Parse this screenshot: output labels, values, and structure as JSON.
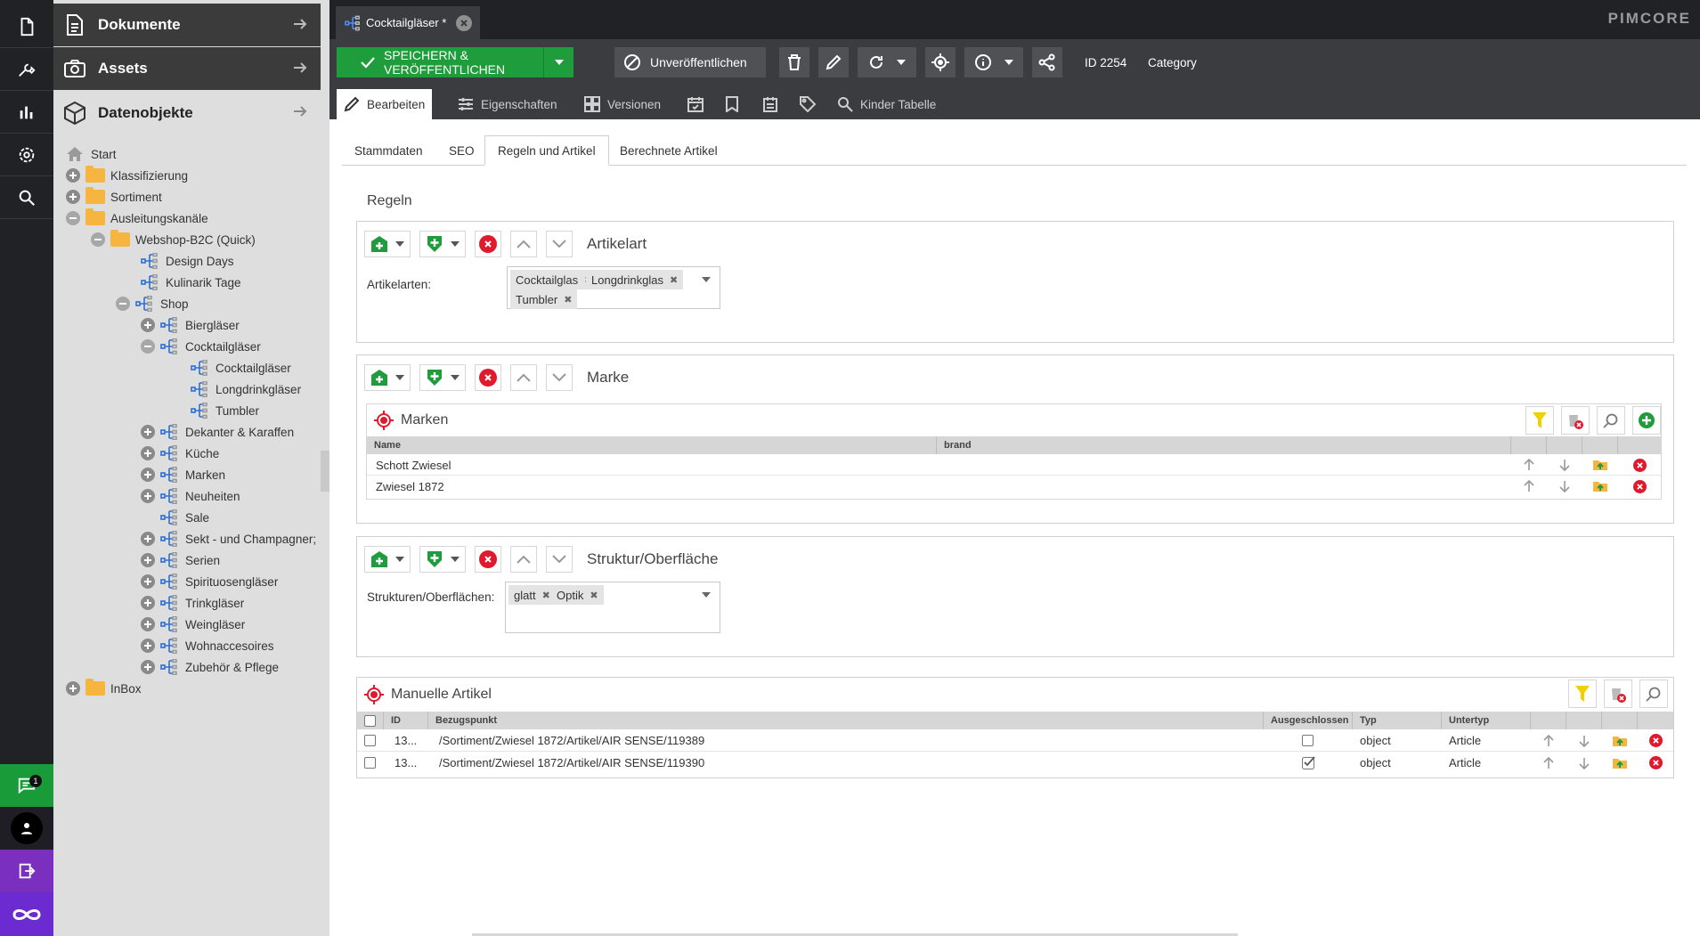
{
  "tree": {
    "accordion": [
      {
        "label": "Dokumente",
        "icon": "document-icon"
      },
      {
        "label": "Assets",
        "icon": "camera-icon"
      },
      {
        "label": "Datenobjekte",
        "icon": "cube-icon"
      }
    ],
    "nodes": {
      "start": "Start",
      "klassifizierung": "Klassifizierung",
      "sortiment": "Sortiment",
      "ausleitungskanaele": "Ausleitungskanäle",
      "webshop": "Webshop-B2C (Quick)",
      "design_days": "Design Days",
      "kulinarik": "Kulinarik Tage",
      "shop": "Shop",
      "bierglaeser": "Biergläser",
      "cocktailglaeser": "Cocktailgläser",
      "cocktailglaeser_sub": "Cocktailgläser",
      "longdrinkglaeser": "Longdrinkgläser",
      "tumbler": "Tumbler",
      "dekanter": "Dekanter & Karaffen",
      "kueche": "Küche",
      "marken": "Marken",
      "neuheiten": "Neuheiten",
      "sale": "Sale",
      "sekt": "Sekt - und Champagner;",
      "serien": "Serien",
      "spirituosen": "Spirituosengläser",
      "trinkglaeser": "Trinkgläser",
      "weinglaeser": "Weingläser",
      "wohnaccesoires": "Wohnaccesoires",
      "zubehoer": "Zubehör & Pflege",
      "inbox": "InBox"
    }
  },
  "iconbar": {
    "chat_badge": "1"
  },
  "header": {
    "tab_title": "Cocktailgläser *",
    "brand": "PIMCORE"
  },
  "toolbar": {
    "save_label": "SPEICHERN & VERÖFFENTLICHEN",
    "unpublish_label": "Unveröffentlichen",
    "id_label": "ID 2254",
    "class_label": "Category"
  },
  "tabs": {
    "edit": "Bearbeiten",
    "properties": "Eigenschaften",
    "versions": "Versionen",
    "children": "Kinder Tabelle"
  },
  "subtabs": [
    "Stammdaten",
    "SEO",
    "Regeln und Artikel",
    "Berechnete Artikel"
  ],
  "rules": {
    "heading": "Regeln",
    "artikelart": {
      "title": "Artikelart",
      "field_label": "Artikelarten:",
      "tags": [
        "Cocktailglas",
        "Longdrinkglas",
        "Tumbler"
      ]
    },
    "marke": {
      "title": "Marke",
      "grid_title": "Marken",
      "columns": [
        "Name",
        "brand"
      ],
      "rows": [
        {
          "name": "Schott Zwiesel",
          "brand": ""
        },
        {
          "name": "Zwiesel 1872",
          "brand": ""
        }
      ]
    },
    "struktur": {
      "title": "Struktur/Oberfläche",
      "field_label": "Strukturen/Oberflächen:",
      "tags": [
        "glatt",
        "Optik"
      ]
    }
  },
  "manual": {
    "title": "Manuelle Artikel",
    "columns": [
      "ID",
      "Bezugspunkt",
      "Ausgeschlossen",
      "Typ",
      "Untertyp"
    ],
    "rows": [
      {
        "id": "13...",
        "path": "/Sortiment/Zwiesel 1872/Artikel/AIR SENSE/119389",
        "excluded": false,
        "type": "object",
        "subtype": "Article"
      },
      {
        "id": "13...",
        "path": "/Sortiment/Zwiesel 1872/Artikel/AIR SENSE/119390",
        "excluded": true,
        "type": "object",
        "subtype": "Article"
      }
    ]
  },
  "colors": {
    "accent_green": "#1f9c3b",
    "danger_red": "#e0192d",
    "filter_yellow": "#f2d000",
    "sidebar_dark": "#202225",
    "toolbar_dark": "#3b3c3f"
  }
}
